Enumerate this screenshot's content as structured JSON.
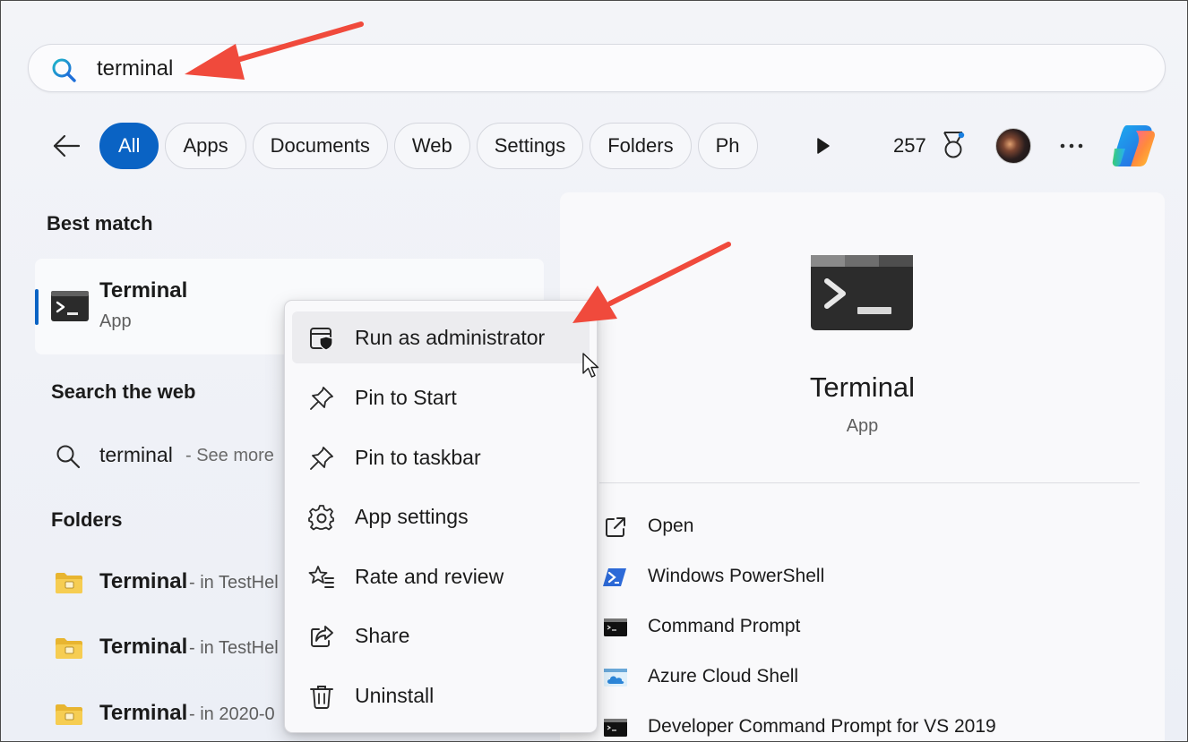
{
  "search": {
    "query": "terminal"
  },
  "filters": {
    "chips": [
      "All",
      "Apps",
      "Documents",
      "Web",
      "Settings",
      "Folders",
      "Ph"
    ],
    "active_index": 0,
    "points": "257"
  },
  "sections": {
    "best_match": "Best match",
    "search_web": "Search the web",
    "folders": "Folders"
  },
  "best_match": {
    "name": "Terminal",
    "type": "App"
  },
  "web_search": {
    "query": "terminal",
    "more_label": "- See more"
  },
  "folders": [
    {
      "name": "Terminal",
      "location": "- in TestHel"
    },
    {
      "name": "Terminal",
      "location": "- in TestHel"
    },
    {
      "name": "Terminal",
      "location": "- in 2020-0"
    }
  ],
  "context_menu": {
    "items": [
      {
        "label": "Run as administrator",
        "icon": "shield-window-icon"
      },
      {
        "label": "Pin to Start",
        "icon": "pin-icon"
      },
      {
        "label": "Pin to taskbar",
        "icon": "pin-icon"
      },
      {
        "label": "App settings",
        "icon": "gear-icon"
      },
      {
        "label": "Rate and review",
        "icon": "star-list-icon"
      },
      {
        "label": "Share",
        "icon": "share-icon"
      },
      {
        "label": "Uninstall",
        "icon": "trash-icon"
      }
    ]
  },
  "preview": {
    "name": "Terminal",
    "type": "App",
    "actions": [
      {
        "label": "Open",
        "icon": "open-external-icon"
      },
      {
        "label": "Windows PowerShell",
        "icon": "powershell-icon"
      },
      {
        "label": "Command Prompt",
        "icon": "cmd-icon"
      },
      {
        "label": "Azure Cloud Shell",
        "icon": "azure-cloud-icon"
      },
      {
        "label": "Developer Command Prompt for VS 2019",
        "icon": "dev-cmd-icon"
      }
    ]
  },
  "colors": {
    "accent": "#0a63c4",
    "annotation_arrow": "#f04a3c"
  }
}
